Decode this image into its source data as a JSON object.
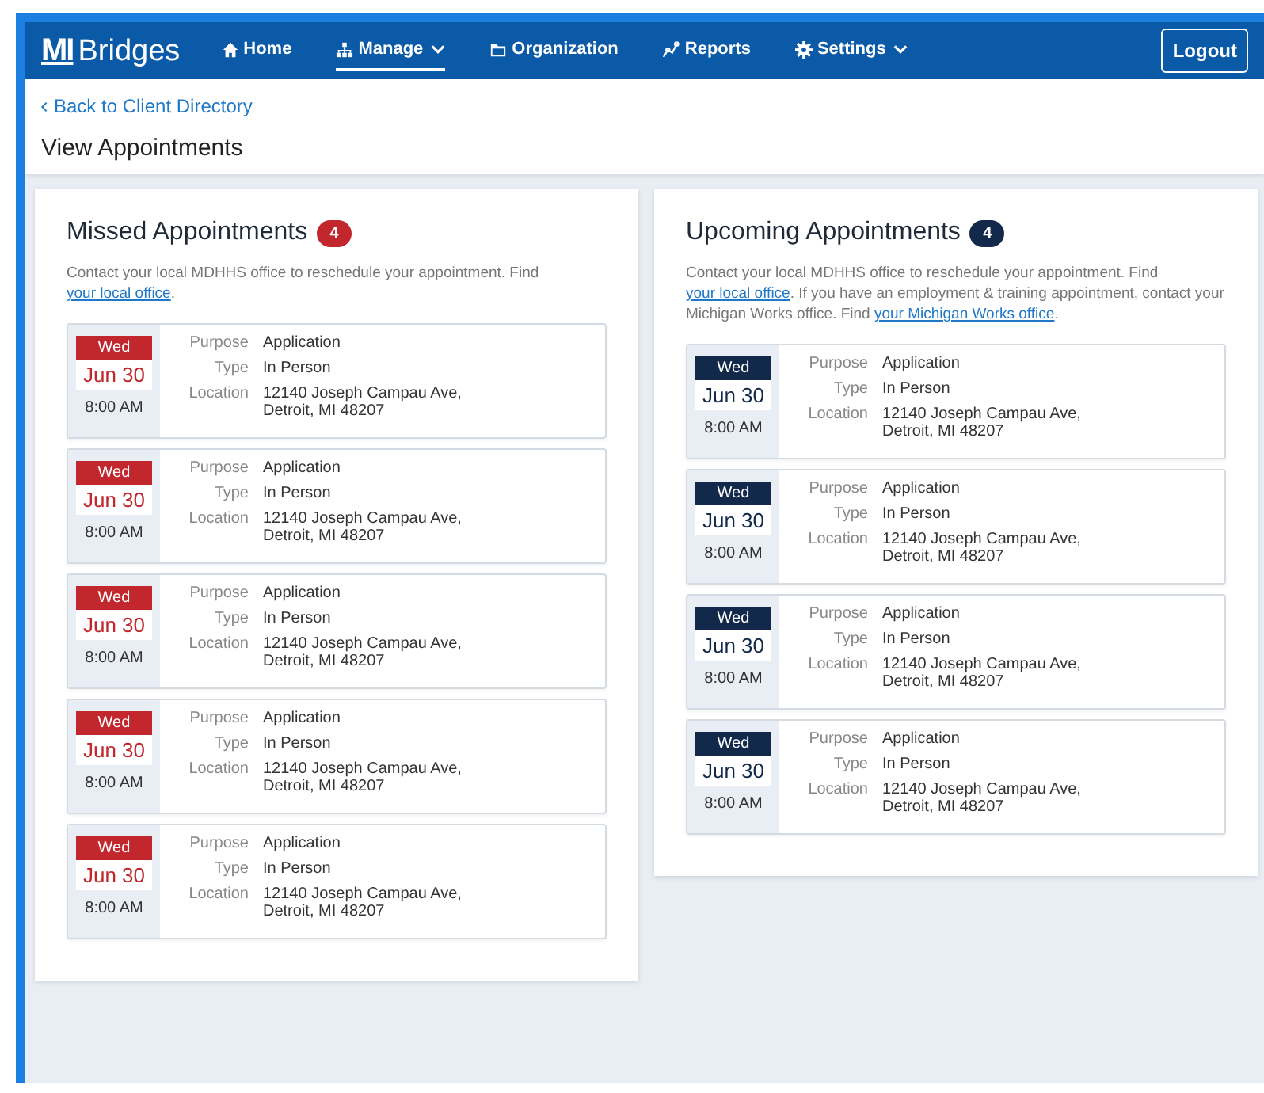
{
  "header": {
    "logo": {
      "mark": "MI",
      "name": "Bridges"
    },
    "nav": [
      {
        "label": "Home",
        "kind": "home",
        "selected": false,
        "dropdown": false
      },
      {
        "label": "Manage",
        "kind": "sitemap",
        "selected": true,
        "dropdown": true
      },
      {
        "label": "Organization",
        "kind": "folder",
        "selected": false,
        "dropdown": false
      },
      {
        "label": "Reports",
        "kind": "graph",
        "selected": false,
        "dropdown": false
      },
      {
        "label": "Settings",
        "kind": "gear",
        "selected": false,
        "dropdown": true
      }
    ],
    "logout": "Logout"
  },
  "back_link": "Back to Client Directory",
  "page_title": "View Appointments",
  "sections": [
    {
      "kind": "missed",
      "title": "Missed Appointments",
      "count": "4",
      "intro": [
        {
          "kind": "text",
          "text": "Contact your local MDHHS office to reschedule your appointment. Find "
        },
        {
          "kind": "link",
          "text": "your local office"
        },
        {
          "kind": "text",
          "text": "."
        }
      ],
      "appointments": [
        {
          "day": "Wed",
          "date": "Jun 30",
          "time": "8:00 AM",
          "purpose_label": "Purpose",
          "purpose": "Application",
          "type_label": "Type",
          "type": "In Person",
          "location_label": "Location",
          "location": [
            "12140 Joseph Campau Ave,",
            "Detroit, MI 48207"
          ]
        },
        {
          "day": "Wed",
          "date": "Jun 30",
          "time": "8:00 AM",
          "purpose_label": "Purpose",
          "purpose": "Application",
          "type_label": "Type",
          "type": "In Person",
          "location_label": "Location",
          "location": [
            "12140 Joseph Campau Ave,",
            "Detroit, MI 48207"
          ]
        },
        {
          "day": "Wed",
          "date": "Jun 30",
          "time": "8:00 AM",
          "purpose_label": "Purpose",
          "purpose": "Application",
          "type_label": "Type",
          "type": "In Person",
          "location_label": "Location",
          "location": [
            "12140 Joseph Campau Ave,",
            "Detroit, MI 48207"
          ]
        },
        {
          "day": "Wed",
          "date": "Jun 30",
          "time": "8:00 AM",
          "purpose_label": "Purpose",
          "purpose": "Application",
          "type_label": "Type",
          "type": "In Person",
          "location_label": "Location",
          "location": [
            "12140 Joseph Campau Ave,",
            "Detroit, MI 48207"
          ]
        },
        {
          "day": "Wed",
          "date": "Jun 30",
          "time": "8:00 AM",
          "purpose_label": "Purpose",
          "purpose": "Application",
          "type_label": "Type",
          "type": "In Person",
          "location_label": "Location",
          "location": [
            "12140 Joseph Campau Ave,",
            "Detroit, MI 48207"
          ]
        }
      ]
    },
    {
      "kind": "upcoming",
      "title": "Upcoming Appointments",
      "count": "4",
      "intro": [
        {
          "kind": "text",
          "text": "Contact your local MDHHS office to reschedule your appointment. Find "
        },
        {
          "kind": "link",
          "text": "your local office"
        },
        {
          "kind": "text",
          "text": ". If you have an employment & training appointment, contact your Michigan Works office. Find "
        },
        {
          "kind": "link",
          "text": "your Michigan Works office"
        },
        {
          "kind": "text",
          "text": "."
        }
      ],
      "appointments": [
        {
          "day": "Wed",
          "date": "Jun 30",
          "time": "8:00 AM",
          "purpose_label": "Purpose",
          "purpose": "Application",
          "type_label": "Type",
          "type": "In Person",
          "location_label": "Location",
          "location": [
            "12140 Joseph Campau Ave,",
            "Detroit, MI 48207"
          ]
        },
        {
          "day": "Wed",
          "date": "Jun 30",
          "time": "8:00 AM",
          "purpose_label": "Purpose",
          "purpose": "Application",
          "type_label": "Type",
          "type": "In Person",
          "location_label": "Location",
          "location": [
            "12140 Joseph Campau Ave,",
            "Detroit, MI 48207"
          ]
        },
        {
          "day": "Wed",
          "date": "Jun 30",
          "time": "8:00 AM",
          "purpose_label": "Purpose",
          "purpose": "Application",
          "type_label": "Type",
          "type": "In Person",
          "location_label": "Location",
          "location": [
            "12140 Joseph Campau Ave,",
            "Detroit, MI 48207"
          ]
        },
        {
          "day": "Wed",
          "date": "Jun 30",
          "time": "8:00 AM",
          "purpose_label": "Purpose",
          "purpose": "Application",
          "type_label": "Type",
          "type": "In Person",
          "location_label": "Location",
          "location": [
            "12140 Joseph Campau Ave,",
            "Detroit, MI 48207"
          ]
        }
      ]
    }
  ]
}
